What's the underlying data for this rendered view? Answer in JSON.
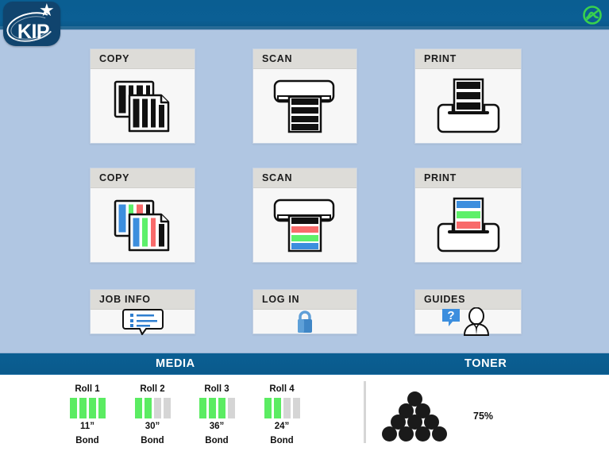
{
  "app": {
    "brand": "KIP",
    "energy_icon": "energy-saver-icon"
  },
  "tiles": [
    {
      "id": "copy-bw",
      "label": "COPY",
      "icon": "copy-bw-icon"
    },
    {
      "id": "scan-bw",
      "label": "SCAN",
      "icon": "scan-bw-icon"
    },
    {
      "id": "print-bw",
      "label": "PRINT",
      "icon": "print-bw-icon"
    },
    {
      "id": "copy-color",
      "label": "COPY",
      "icon": "copy-color-icon"
    },
    {
      "id": "scan-color",
      "label": "SCAN",
      "icon": "scan-color-icon"
    },
    {
      "id": "print-color",
      "label": "PRINT",
      "icon": "print-color-icon"
    },
    {
      "id": "job-info",
      "label": "JOB INFO",
      "icon": "job-info-icon"
    },
    {
      "id": "log-in",
      "label": "LOG IN",
      "icon": "padlock-icon"
    },
    {
      "id": "guides",
      "label": "GUIDES",
      "icon": "guides-person-help-icon"
    }
  ],
  "status": {
    "media_label": "MEDIA",
    "toner_label": "TONER"
  },
  "media": {
    "rolls": [
      {
        "name": "Roll 1",
        "size": "11”",
        "type": "Bond",
        "level": 4,
        "segments": 4
      },
      {
        "name": "Roll 2",
        "size": "30”",
        "type": "Bond",
        "level": 2,
        "segments": 4
      },
      {
        "name": "Roll 3",
        "size": "36”",
        "type": "Bond",
        "level": 3,
        "segments": 4
      },
      {
        "name": "Roll 4",
        "size": "24”",
        "type": "Bond",
        "level": 2,
        "segments": 4
      }
    ]
  },
  "toner": {
    "percent_label": "75%",
    "percent": 75,
    "dots": 10
  },
  "colors": {
    "header_blue": "#0a5e92",
    "background_blue": "#b0c6e2",
    "tile_header_gray": "#dddcd8",
    "tile_body": "#f7f7f7",
    "media_level_green": "#5bec62",
    "media_level_empty": "#d5d5d5",
    "accent_blue": "#3c8ede",
    "toner_dot": "#1a1a1a",
    "energy_green": "#39d14e"
  }
}
